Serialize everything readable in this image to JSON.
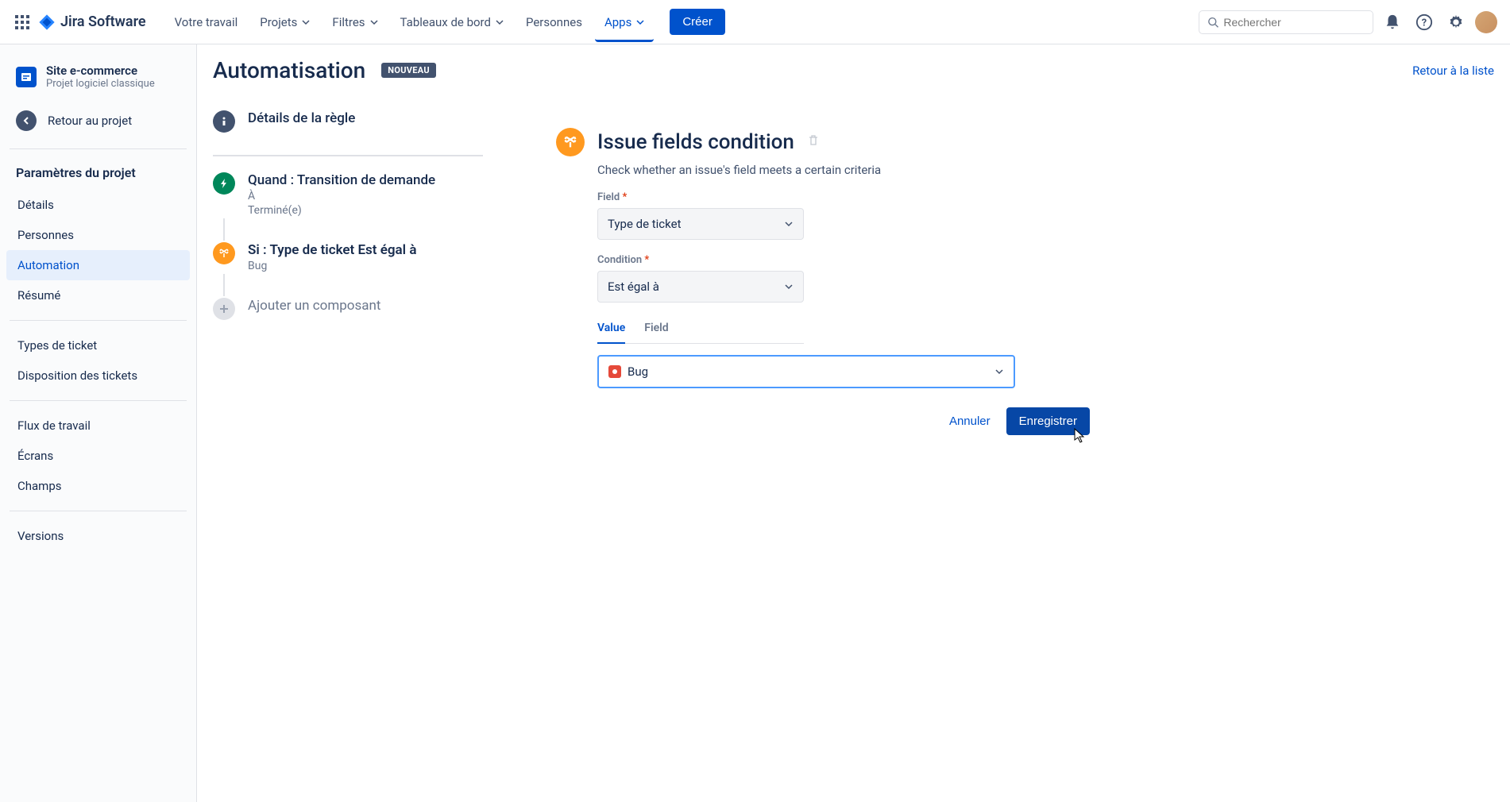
{
  "topnav": {
    "product": "Jira Software",
    "items": [
      "Votre travail",
      "Projets",
      "Filtres",
      "Tableaux de bord",
      "Personnes",
      "Apps"
    ],
    "items_has_chevron": [
      false,
      true,
      true,
      true,
      false,
      true
    ],
    "active_index": 5,
    "create": "Créer",
    "search_placeholder": "Rechercher"
  },
  "sidebar": {
    "project_name": "Site e-commerce",
    "project_type": "Projet logiciel classique",
    "back": "Retour au projet",
    "heading": "Paramètres du projet",
    "group1": [
      "Détails",
      "Personnes",
      "Automation",
      "Résumé"
    ],
    "group1_selected_index": 2,
    "group2": [
      "Types de ticket",
      "Disposition des tickets"
    ],
    "group3": [
      "Flux de travail",
      "Écrans",
      "Champs"
    ],
    "group4": [
      "Versions"
    ]
  },
  "content": {
    "title": "Automatisation",
    "badge": "NOUVEAU",
    "return_link": "Retour à la liste"
  },
  "rule": {
    "details": "Détails de la règle",
    "trigger_title": "Quand : Transition de demande",
    "trigger_sub1": "À",
    "trigger_sub2": "Terminé(e)",
    "condition_title": "Si : Type de ticket Est égal à",
    "condition_sub": "Bug",
    "add": "Ajouter un composant"
  },
  "detail": {
    "title": "Issue fields condition",
    "desc": "Check whether an issue's field meets a certain criteria",
    "field_label": "Field",
    "field_value": "Type de ticket",
    "condition_label": "Condition",
    "condition_value": "Est égal à",
    "tab_value": "Value",
    "tab_field": "Field",
    "value_selected": "Bug",
    "cancel": "Annuler",
    "save": "Enregistrer"
  }
}
